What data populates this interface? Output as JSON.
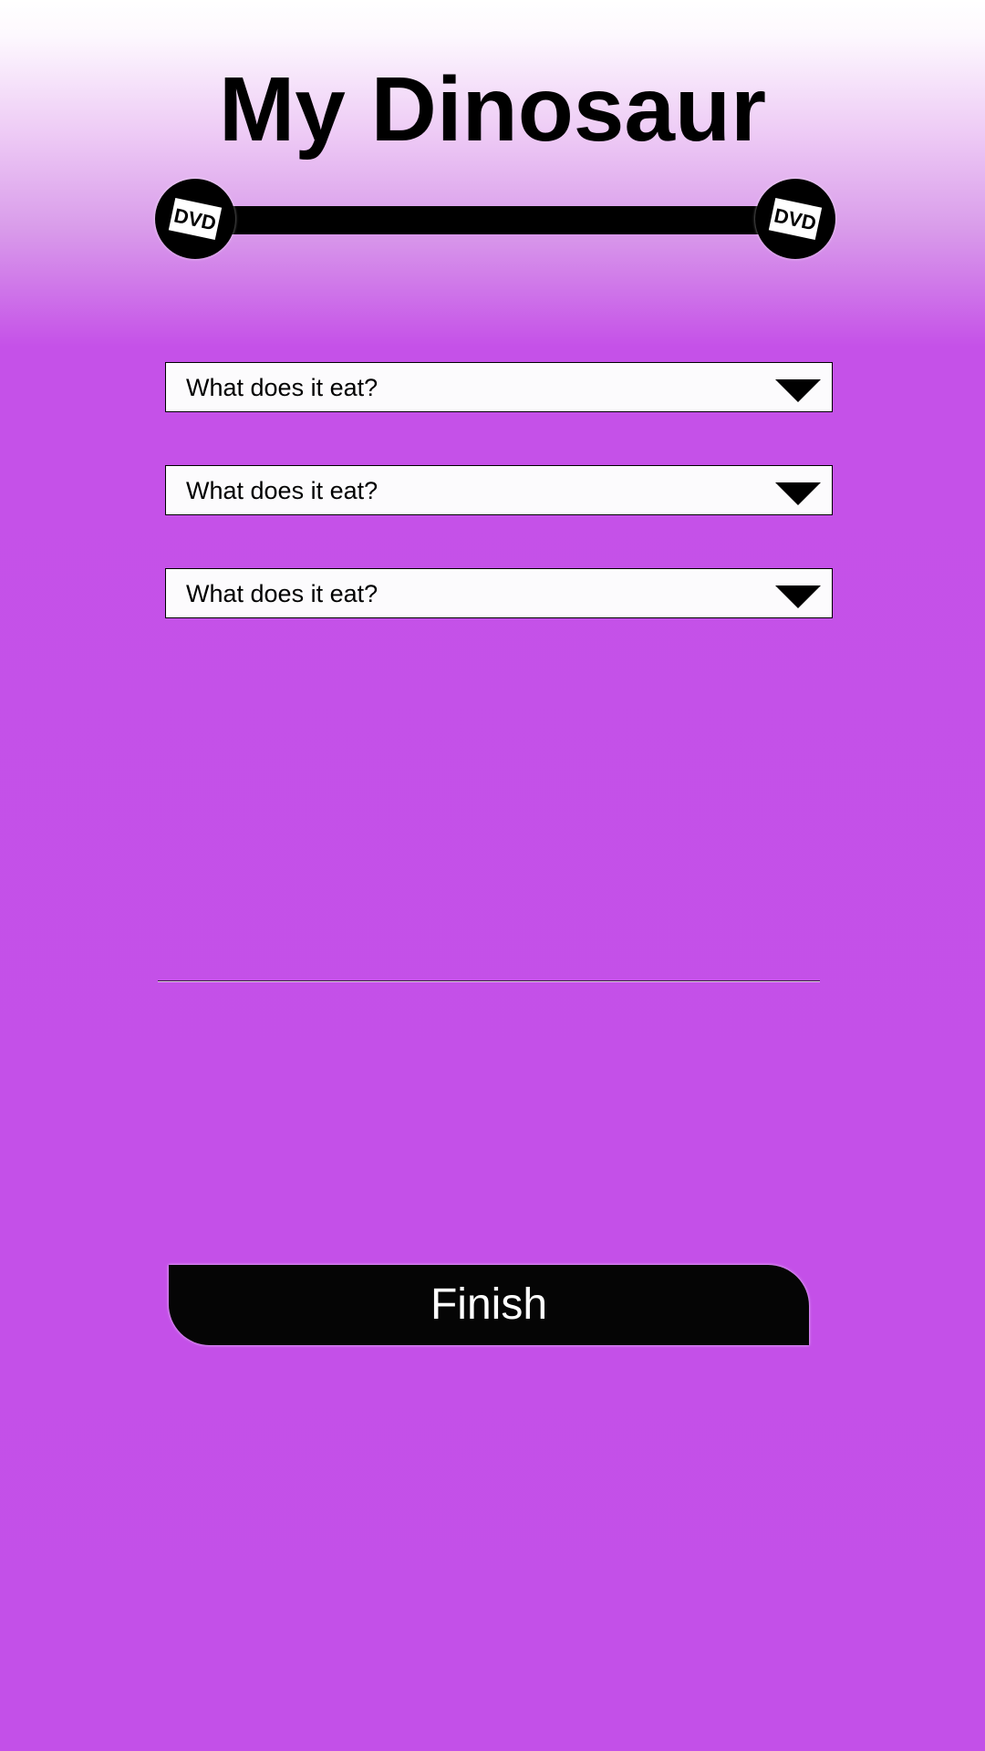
{
  "header": {
    "title": "My Dinosaur",
    "slider_left_icon": "dvd-logo-icon",
    "slider_right_icon": "dvd-logo-icon"
  },
  "form": {
    "dropdowns": [
      {
        "placeholder": "What does it eat?"
      },
      {
        "placeholder": "What does it eat?"
      },
      {
        "placeholder": "What does it eat?"
      }
    ]
  },
  "actions": {
    "finish_label": "Finish"
  },
  "colors": {
    "background": "#c350e8",
    "button": "#050505",
    "dropdown_fill": "#fcfbfd"
  }
}
